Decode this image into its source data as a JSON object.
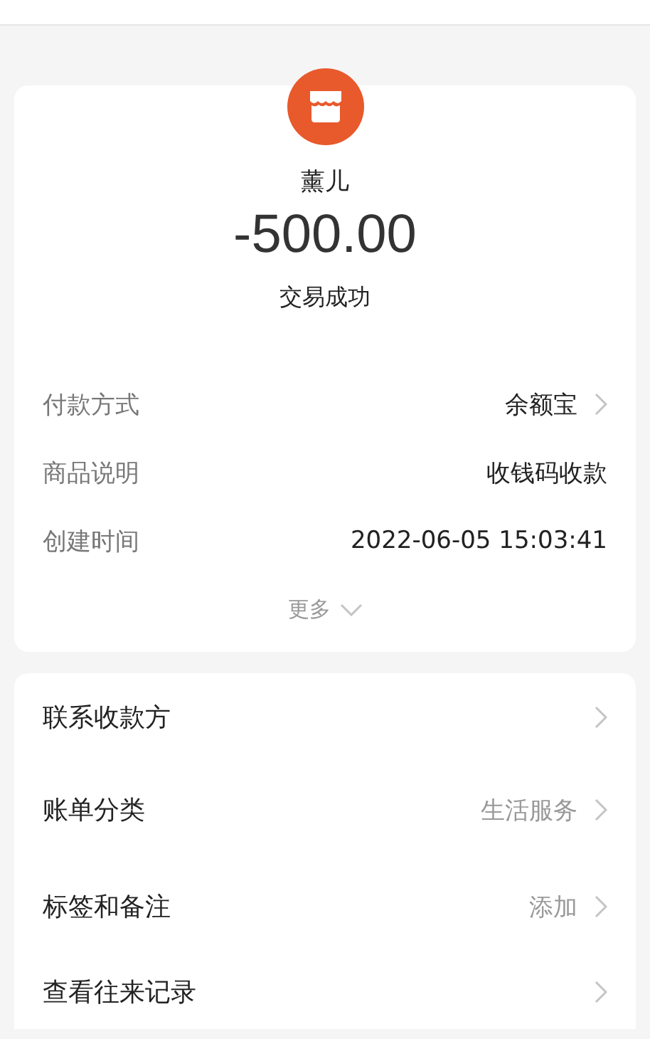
{
  "payee": {
    "name": "薰儿",
    "amount": "-500.00",
    "status": "交易成功"
  },
  "details": [
    {
      "label": "付款方式",
      "value": "余额宝",
      "chevron": true
    },
    {
      "label": "商品说明",
      "value": "收钱码收款",
      "chevron": false
    },
    {
      "label": "创建时间",
      "value": "2022-06-05 15:03:41",
      "chevron": false
    }
  ],
  "more": {
    "label": "更多"
  },
  "actions": [
    {
      "label": "联系收款方"
    },
    {
      "label": "账单分类",
      "value": "生活服务"
    },
    {
      "label": "标签和备注",
      "value": "添加"
    },
    {
      "label": "查看往来记录"
    }
  ]
}
